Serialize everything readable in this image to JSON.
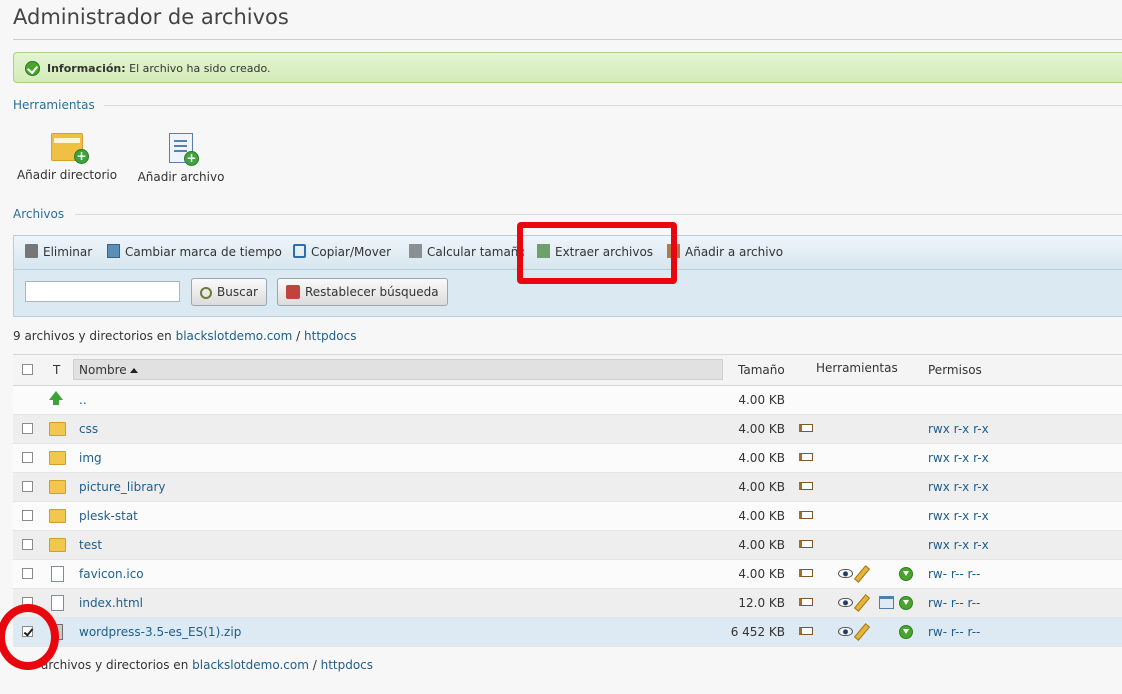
{
  "page": {
    "title": "Administrador de archivos"
  },
  "message": {
    "label": "Información:",
    "text": "El archivo ha sido creado."
  },
  "tools_section": {
    "title": "Herramientas",
    "items": [
      {
        "label": "Añadir directorio",
        "icon": "add-folder-icon"
      },
      {
        "label": "Añadir archivo",
        "icon": "add-file-icon"
      }
    ]
  },
  "files_section": {
    "title": "Archivos"
  },
  "toolbar": {
    "buttons": [
      {
        "label": "Eliminar",
        "icon": "trash-icon"
      },
      {
        "label": "Cambiar marca de tiempo",
        "icon": "timestamp-icon"
      },
      {
        "label": "Copiar/Mover",
        "icon": "copy-move-icon"
      },
      {
        "label": "Calcular tamaño",
        "icon": "calculator-icon"
      },
      {
        "label": "Extraer archivos",
        "icon": "extract-icon"
      },
      {
        "label": "Añadir a archivo",
        "icon": "add-archive-icon"
      }
    ],
    "search_value": "",
    "search_button": "Buscar",
    "reset_button": "Restablecer búsqueda"
  },
  "summary": {
    "text": "9 archivos y directorios en",
    "bottom_text": "archivos y directorios en",
    "domain": "blackslotdemo.com",
    "separator": "/",
    "folder": "httpdocs"
  },
  "table": {
    "headers": {
      "type": "T",
      "name": "Nombre",
      "size": "Tamaño",
      "tools": "Herramientas",
      "perms": "Permisos"
    },
    "rows": [
      {
        "name": "..",
        "size": "4.00 KB",
        "perms": "",
        "type": "up"
      },
      {
        "name": "css",
        "size": "4.00 KB",
        "perms": "rwx r-x r-x",
        "type": "folder"
      },
      {
        "name": "img",
        "size": "4.00 KB",
        "perms": "rwx r-x r-x",
        "type": "folder"
      },
      {
        "name": "picture_library",
        "size": "4.00 KB",
        "perms": "rwx r-x r-x",
        "type": "folder"
      },
      {
        "name": "plesk-stat",
        "size": "4.00 KB",
        "perms": "rwx r-x r-x",
        "type": "folder"
      },
      {
        "name": "test",
        "size": "4.00 KB",
        "perms": "rwx r-x r-x",
        "type": "folder"
      },
      {
        "name": "favicon.ico",
        "size": "4.00 KB",
        "perms": "rw- r-- r--",
        "type": "file"
      },
      {
        "name": "index.html",
        "size": "12.0 KB",
        "perms": "rw- r-- r--",
        "type": "file"
      },
      {
        "name": "wordpress-3.5-es_ES(1).zip",
        "size": "6 452 KB",
        "perms": "rw- r-- r--",
        "type": "zip",
        "checked": true
      }
    ]
  },
  "colors": {
    "accent": "#1f5d8a",
    "highlight": "#e8070e",
    "success": "#4aa52e"
  }
}
